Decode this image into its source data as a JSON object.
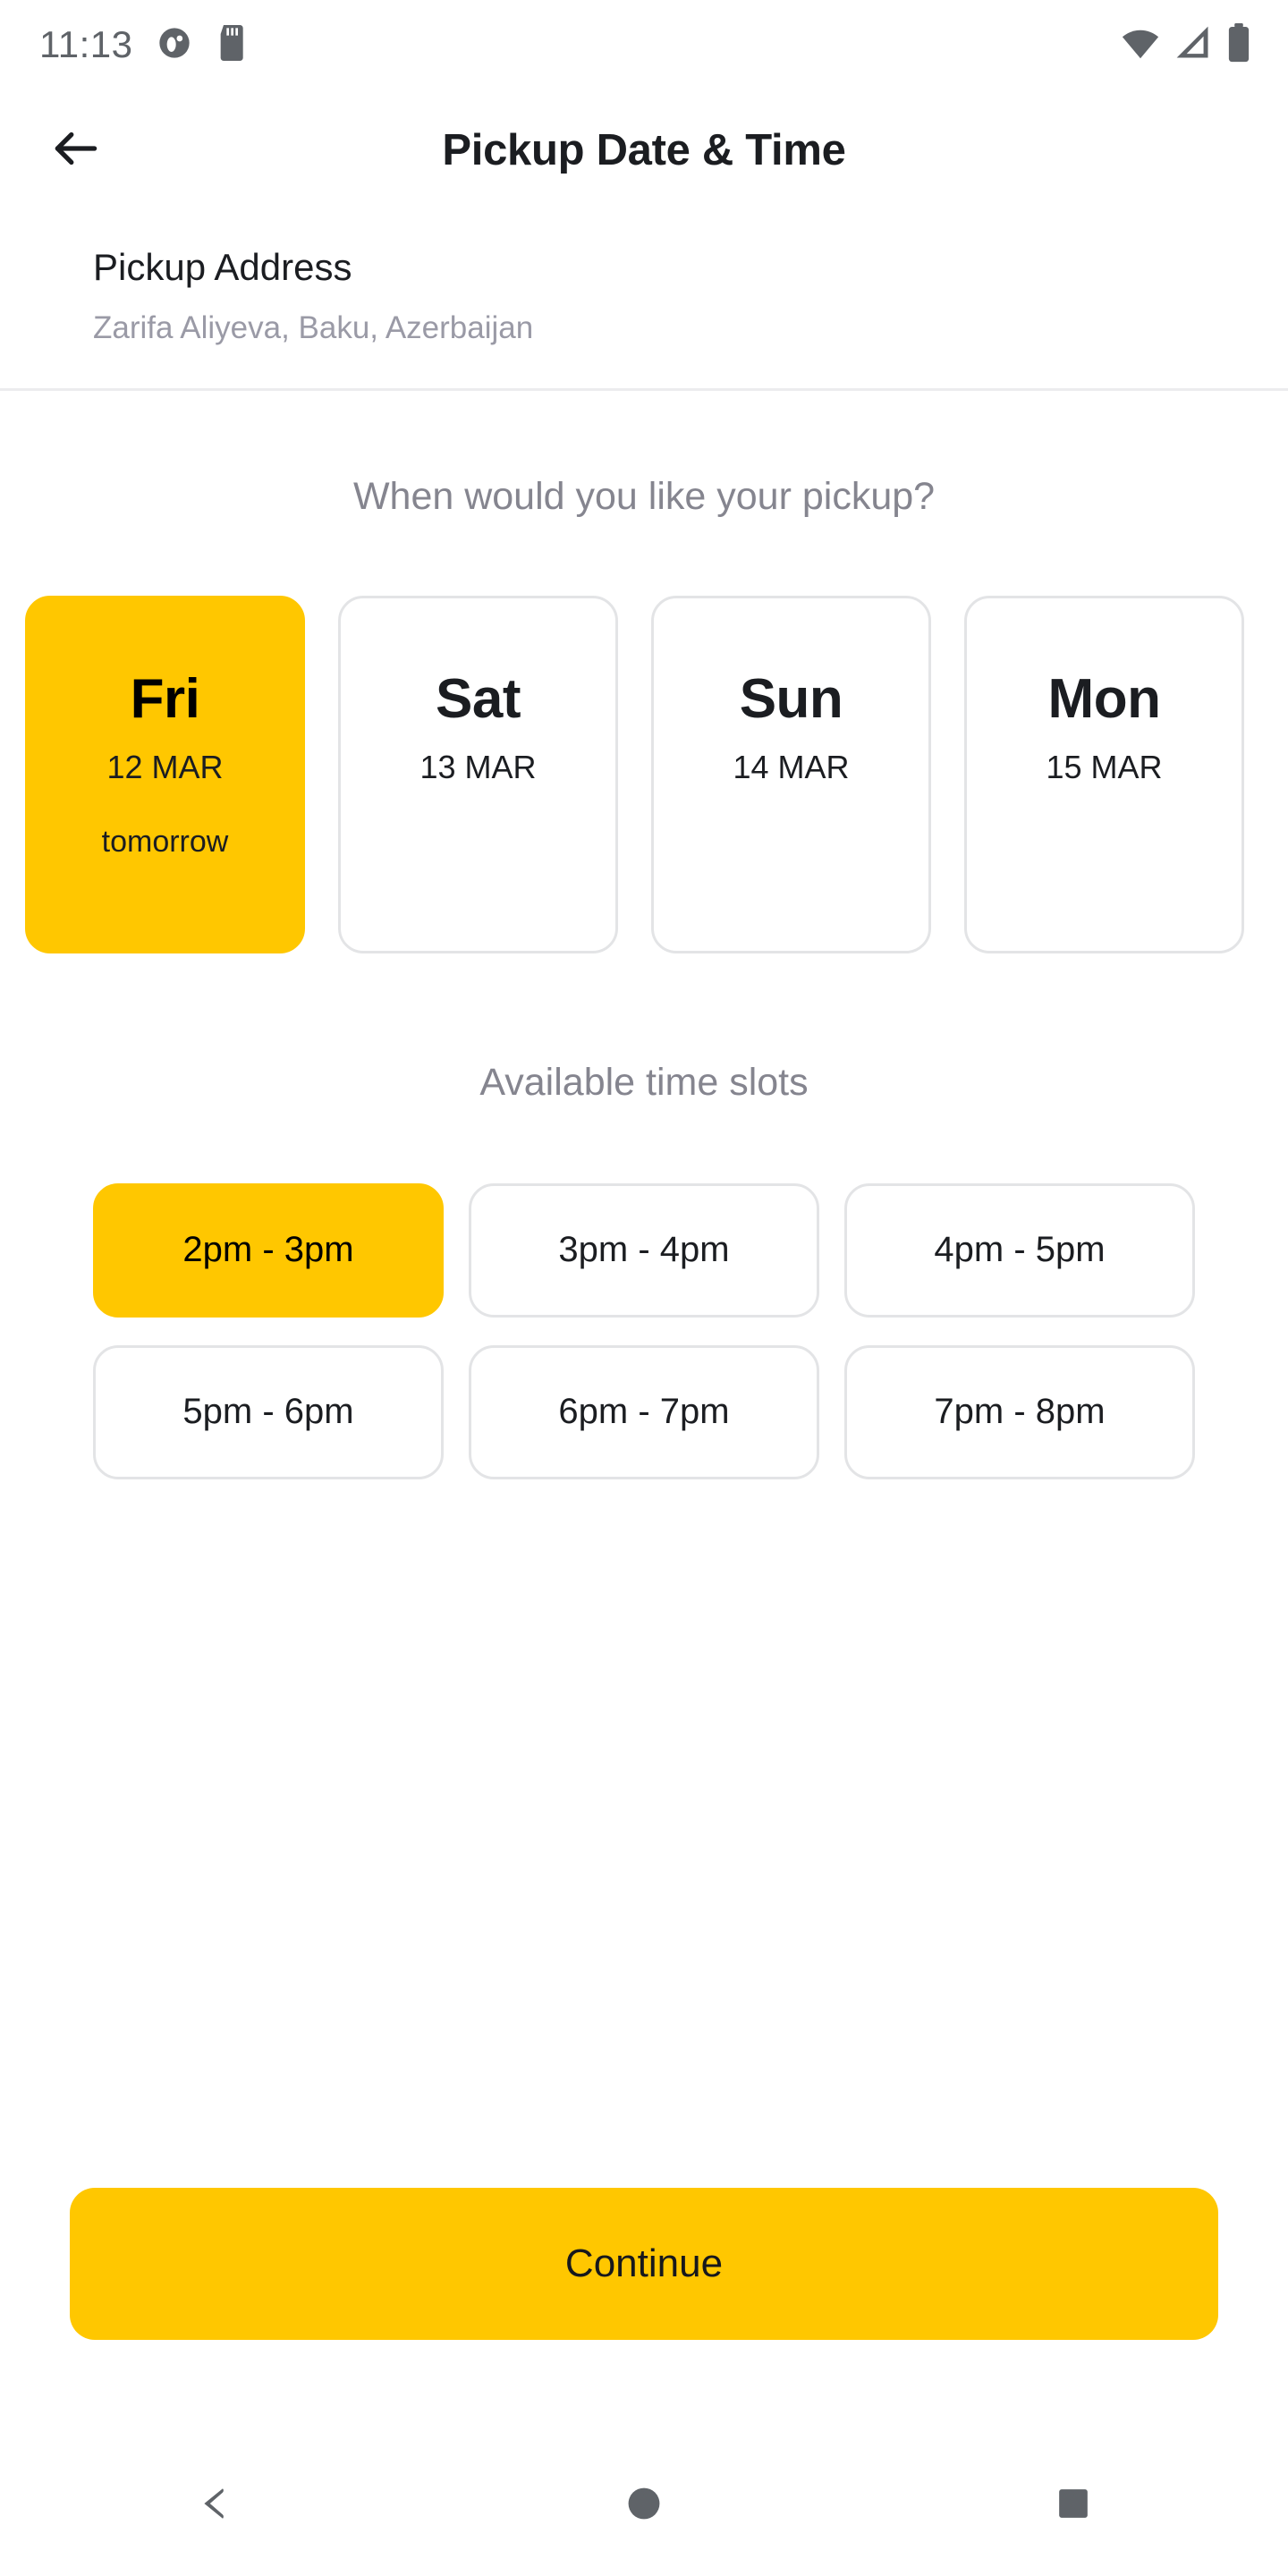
{
  "status_bar": {
    "time": "11:13",
    "icons_left": [
      "app-notification-icon",
      "sd-card-icon"
    ],
    "icons_right": [
      "wifi-icon",
      "cellular-signal-icon",
      "battery-icon"
    ]
  },
  "app_bar": {
    "back_icon": "arrow-left-icon",
    "title": "Pickup Date & Time"
  },
  "address": {
    "label": "Pickup Address",
    "value": "Zarifa Aliyeva, Baku, Azerbaijan"
  },
  "date_section": {
    "prompt": "When would you like your pickup?",
    "cards": [
      {
        "dow": "Fri",
        "date": "12 MAR",
        "relative": "tomorrow",
        "selected": true
      },
      {
        "dow": "Sat",
        "date": "13 MAR",
        "relative": "",
        "selected": false
      },
      {
        "dow": "Sun",
        "date": "14 MAR",
        "relative": "",
        "selected": false
      },
      {
        "dow": "Mon",
        "date": "15 MAR",
        "relative": "",
        "selected": false
      }
    ]
  },
  "slots_section": {
    "heading": "Available time slots",
    "slots": [
      {
        "label": "2pm - 3pm",
        "selected": true
      },
      {
        "label": "3pm - 4pm",
        "selected": false
      },
      {
        "label": "4pm - 5pm",
        "selected": false
      },
      {
        "label": "5pm - 6pm",
        "selected": false
      },
      {
        "label": "6pm - 7pm",
        "selected": false
      },
      {
        "label": "7pm - 8pm",
        "selected": false
      }
    ]
  },
  "footer": {
    "continue_label": "Continue"
  },
  "nav_bar": {
    "back_icon": "triangle-back-icon",
    "home_icon": "circle-home-icon",
    "recents_icon": "square-recents-icon"
  },
  "colors": {
    "accent": "#ffc700",
    "text_primary": "#1b1d21",
    "text_muted": "#85858f",
    "border": "#e3e4e6",
    "divider": "#ececee",
    "status_gray": "#5f6368"
  }
}
